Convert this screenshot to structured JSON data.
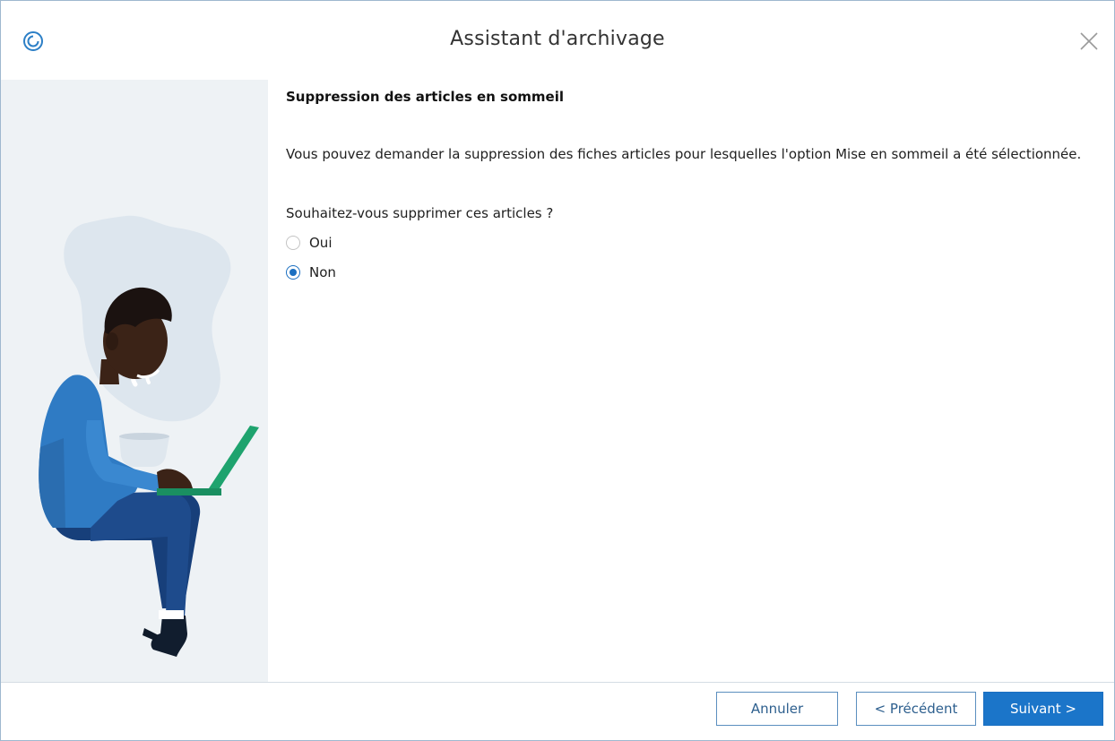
{
  "window": {
    "title": "Assistant d'archivage"
  },
  "titlebar": {
    "app_icon": "app-logo-icon",
    "close_icon": "close-icon"
  },
  "content": {
    "heading": "Suppression des articles en sommeil",
    "description": "Vous pouvez demander la suppression des fiches articles pour lesquelles l'option Mise en sommeil a été sélectionnée.",
    "question": "Souhaitez-vous supprimer ces articles ?",
    "options": [
      {
        "label": "Oui",
        "checked": false
      },
      {
        "label": "Non",
        "checked": true
      }
    ]
  },
  "footer": {
    "cancel_label": "Annuler",
    "prev_label": "< Précédent",
    "next_label": "Suivant >"
  },
  "colors": {
    "accent": "#1b75c9",
    "sidebar_bg": "#eef2f5",
    "button_border": "#5b8fbf"
  }
}
